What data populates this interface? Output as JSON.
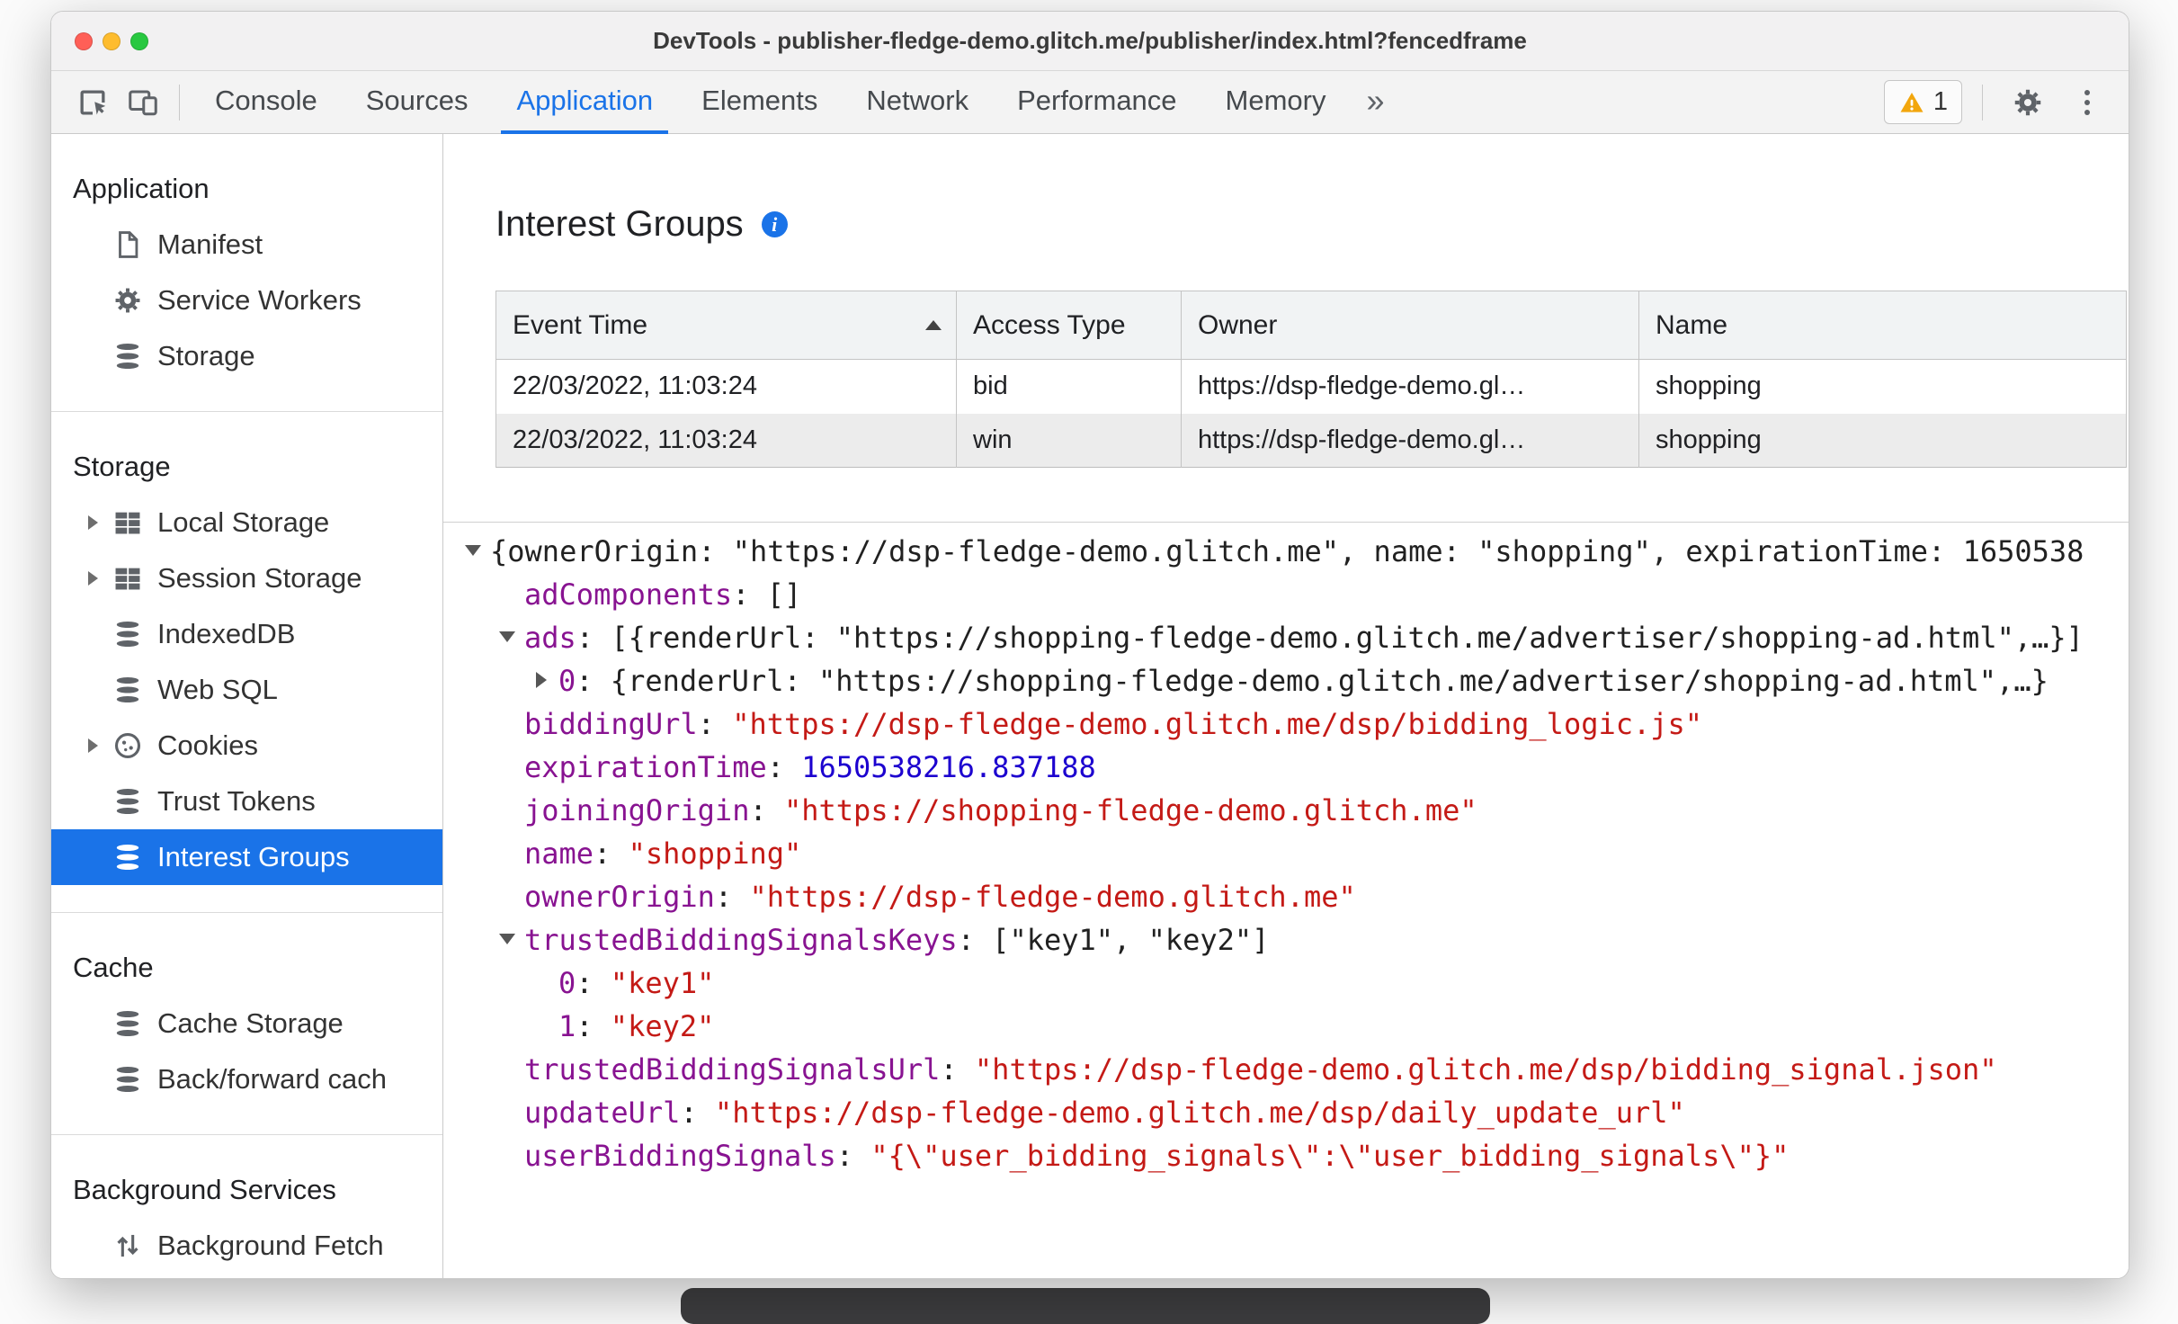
{
  "window": {
    "title": "DevTools - publisher-fledge-demo.glitch.me/publisher/index.html?fencedframe"
  },
  "colors": {
    "accent": "#1a73e8",
    "selected_item_bg": "#1a73e8",
    "warning": "#f2a60d",
    "syntax_property": "#881391",
    "syntax_string": "#c41a16",
    "syntax_number": "#1c00cf"
  },
  "toolbar": {
    "icons": [
      "inspect-icon",
      "device-toolbar-icon",
      "warning-icon",
      "gear-icon",
      "more-options-icon"
    ],
    "tabs": [
      {
        "label": "Console",
        "selected": false
      },
      {
        "label": "Sources",
        "selected": false
      },
      {
        "label": "Application",
        "selected": true
      },
      {
        "label": "Elements",
        "selected": false
      },
      {
        "label": "Network",
        "selected": false
      },
      {
        "label": "Performance",
        "selected": false
      },
      {
        "label": "Memory",
        "selected": false
      }
    ],
    "more_tabs_label": "»",
    "warning_count": "1"
  },
  "sidebar": {
    "sections": [
      {
        "title": "Application",
        "items": [
          {
            "label": "Manifest",
            "icon": "document-icon"
          },
          {
            "label": "Service Workers",
            "icon": "gear-icon"
          },
          {
            "label": "Storage",
            "icon": "database-icon"
          }
        ]
      },
      {
        "title": "Storage",
        "items": [
          {
            "label": "Local Storage",
            "icon": "table-icon",
            "expandable": true
          },
          {
            "label": "Session Storage",
            "icon": "table-icon",
            "expandable": true
          },
          {
            "label": "IndexedDB",
            "icon": "database-icon"
          },
          {
            "label": "Web SQL",
            "icon": "database-icon"
          },
          {
            "label": "Cookies",
            "icon": "cookie-icon",
            "expandable": true
          },
          {
            "label": "Trust Tokens",
            "icon": "database-icon"
          },
          {
            "label": "Interest Groups",
            "icon": "database-icon",
            "selected": true
          }
        ]
      },
      {
        "title": "Cache",
        "items": [
          {
            "label": "Cache Storage",
            "icon": "database-icon"
          },
          {
            "label": "Back/forward cach",
            "icon": "database-icon"
          }
        ]
      },
      {
        "title": "Background Services",
        "items": [
          {
            "label": "Background Fetch",
            "icon": "fetch-icon"
          }
        ]
      }
    ]
  },
  "main": {
    "heading": "Interest Groups",
    "table": {
      "columns": [
        "Event Time",
        "Access Type",
        "Owner",
        "Name"
      ],
      "sorted_column": "Event Time",
      "sort_direction": "ascending",
      "rows": [
        [
          "22/03/2022, 11:03:24",
          "bid",
          "https://dsp-fledge-demo.gl…",
          "shopping"
        ],
        [
          "22/03/2022, 11:03:24",
          "win",
          "https://dsp-fledge-demo.gl…",
          "shopping"
        ]
      ]
    },
    "tree": {
      "lines": [
        {
          "indent": 0,
          "arrow": "open",
          "segments": [
            [
              "plain",
              "{ownerOrigin: \"https://dsp-fledge-demo.glitch.me\", name: \"shopping\", expirationTime: 1650538"
            ]
          ]
        },
        {
          "indent": 1,
          "arrow": null,
          "segments": [
            [
              "key",
              "adComponents"
            ],
            [
              "plain",
              ": []"
            ]
          ]
        },
        {
          "indent": 1,
          "arrow": "open",
          "segments": [
            [
              "key",
              "ads"
            ],
            [
              "plain",
              ": [{renderUrl: \"https://shopping-fledge-demo.glitch.me/advertiser/shopping-ad.html\",…}]"
            ]
          ]
        },
        {
          "indent": 2,
          "arrow": "closed",
          "segments": [
            [
              "key",
              "0"
            ],
            [
              "plain",
              ": {renderUrl: \"https://shopping-fledge-demo.glitch.me/advertiser/shopping-ad.html\",…}"
            ]
          ]
        },
        {
          "indent": 1,
          "arrow": null,
          "segments": [
            [
              "key",
              "biddingUrl"
            ],
            [
              "plain",
              ": "
            ],
            [
              "str",
              "\"https://dsp-fledge-demo.glitch.me/dsp/bidding_logic.js\""
            ]
          ]
        },
        {
          "indent": 1,
          "arrow": null,
          "segments": [
            [
              "key",
              "expirationTime"
            ],
            [
              "plain",
              ": "
            ],
            [
              "num",
              "1650538216.837188"
            ]
          ]
        },
        {
          "indent": 1,
          "arrow": null,
          "segments": [
            [
              "key",
              "joiningOrigin"
            ],
            [
              "plain",
              ": "
            ],
            [
              "str",
              "\"https://shopping-fledge-demo.glitch.me\""
            ]
          ]
        },
        {
          "indent": 1,
          "arrow": null,
          "segments": [
            [
              "key",
              "name"
            ],
            [
              "plain",
              ": "
            ],
            [
              "str",
              "\"shopping\""
            ]
          ]
        },
        {
          "indent": 1,
          "arrow": null,
          "segments": [
            [
              "key",
              "ownerOrigin"
            ],
            [
              "plain",
              ": "
            ],
            [
              "str",
              "\"https://dsp-fledge-demo.glitch.me\""
            ]
          ]
        },
        {
          "indent": 1,
          "arrow": "open",
          "segments": [
            [
              "key",
              "trustedBiddingSignalsKeys"
            ],
            [
              "plain",
              ": [\"key1\", \"key2\"]"
            ]
          ]
        },
        {
          "indent": 2,
          "arrow": null,
          "segments": [
            [
              "key",
              "0"
            ],
            [
              "plain",
              ": "
            ],
            [
              "str",
              "\"key1\""
            ]
          ]
        },
        {
          "indent": 2,
          "arrow": null,
          "segments": [
            [
              "key",
              "1"
            ],
            [
              "plain",
              ": "
            ],
            [
              "str",
              "\"key2\""
            ]
          ]
        },
        {
          "indent": 1,
          "arrow": null,
          "segments": [
            [
              "key",
              "trustedBiddingSignalsUrl"
            ],
            [
              "plain",
              ": "
            ],
            [
              "str",
              "\"https://dsp-fledge-demo.glitch.me/dsp/bidding_signal.json\""
            ]
          ]
        },
        {
          "indent": 1,
          "arrow": null,
          "segments": [
            [
              "key",
              "updateUrl"
            ],
            [
              "plain",
              ": "
            ],
            [
              "str",
              "\"https://dsp-fledge-demo.glitch.me/dsp/daily_update_url\""
            ]
          ]
        },
        {
          "indent": 1,
          "arrow": null,
          "segments": [
            [
              "key",
              "userBiddingSignals"
            ],
            [
              "plain",
              ": "
            ],
            [
              "str",
              "\"{\\\"user_bidding_signals\\\":\\\"user_bidding_signals\\\"}\""
            ]
          ]
        }
      ]
    }
  }
}
